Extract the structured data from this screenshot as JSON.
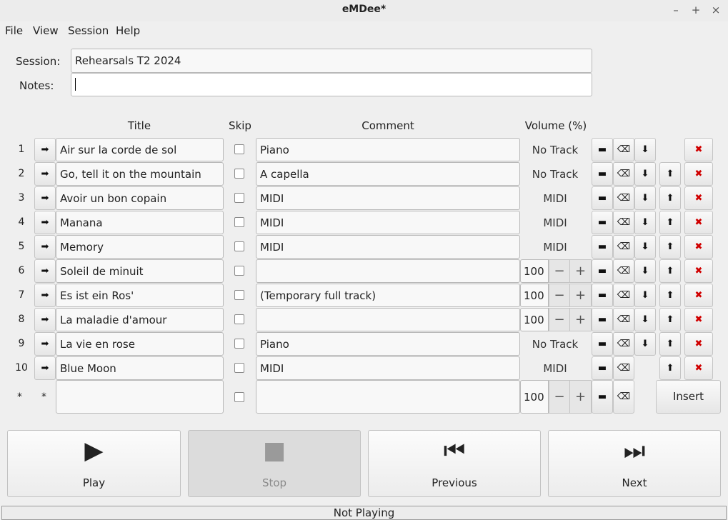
{
  "window": {
    "title": "eMDee*",
    "controls": [
      "–",
      "+",
      "×"
    ]
  },
  "menu": [
    "File",
    "View",
    "Session",
    "Help"
  ],
  "session": {
    "label": "Session:",
    "value": "Rehearsals T2 2024"
  },
  "notes": {
    "label": "Notes:",
    "value": ""
  },
  "columns": {
    "title": "Title",
    "skip": "Skip",
    "comment": "Comment",
    "volume": "Volume (%)"
  },
  "rows": [
    {
      "num": "1",
      "title": "Air sur la corde de sol",
      "comment": "Piano",
      "volume": "No Track",
      "spin": false,
      "down": true,
      "up": false
    },
    {
      "num": "2",
      "title": "Go, tell it on the mountain",
      "comment": "A capella",
      "volume": "No Track",
      "spin": false,
      "down": true,
      "up": true
    },
    {
      "num": "3",
      "title": "Avoir un bon copain",
      "comment": "MIDI",
      "volume": "MIDI",
      "spin": false,
      "down": true,
      "up": true
    },
    {
      "num": "4",
      "title": "Manana",
      "comment": "MIDI",
      "volume": "MIDI",
      "spin": false,
      "down": true,
      "up": true
    },
    {
      "num": "5",
      "title": "Memory",
      "comment": "MIDI",
      "volume": "MIDI",
      "spin": false,
      "down": true,
      "up": true
    },
    {
      "num": "6",
      "title": "Soleil de minuit",
      "comment": "",
      "volume": "100",
      "spin": true,
      "down": true,
      "up": true
    },
    {
      "num": "7",
      "title": "Es ist ein Ros'",
      "comment": "(Temporary full track)",
      "volume": "100",
      "spin": true,
      "down": true,
      "up": true
    },
    {
      "num": "8",
      "title": "La maladie d'amour",
      "comment": "",
      "volume": "100",
      "spin": true,
      "down": true,
      "up": true
    },
    {
      "num": "9",
      "title": "La vie en rose",
      "comment": "Piano",
      "volume": "No Track",
      "spin": false,
      "down": true,
      "up": true
    },
    {
      "num": "10",
      "title": "Blue Moon",
      "comment": "MIDI",
      "volume": "MIDI",
      "spin": false,
      "down": false,
      "up": true
    }
  ],
  "new_row": {
    "marker1": "*",
    "marker2": "*",
    "title": "",
    "comment": "",
    "volume": "100",
    "insert_label": "Insert"
  },
  "transport": [
    {
      "name": "play",
      "label": "Play",
      "icon": "play-icon",
      "enabled": true
    },
    {
      "name": "stop",
      "label": "Stop",
      "icon": "stop-icon",
      "enabled": false
    },
    {
      "name": "previous",
      "label": "Previous",
      "icon": "previous-icon",
      "enabled": true
    },
    {
      "name": "next",
      "label": "Next",
      "icon": "next-icon",
      "enabled": true
    }
  ],
  "status": "Not Playing"
}
